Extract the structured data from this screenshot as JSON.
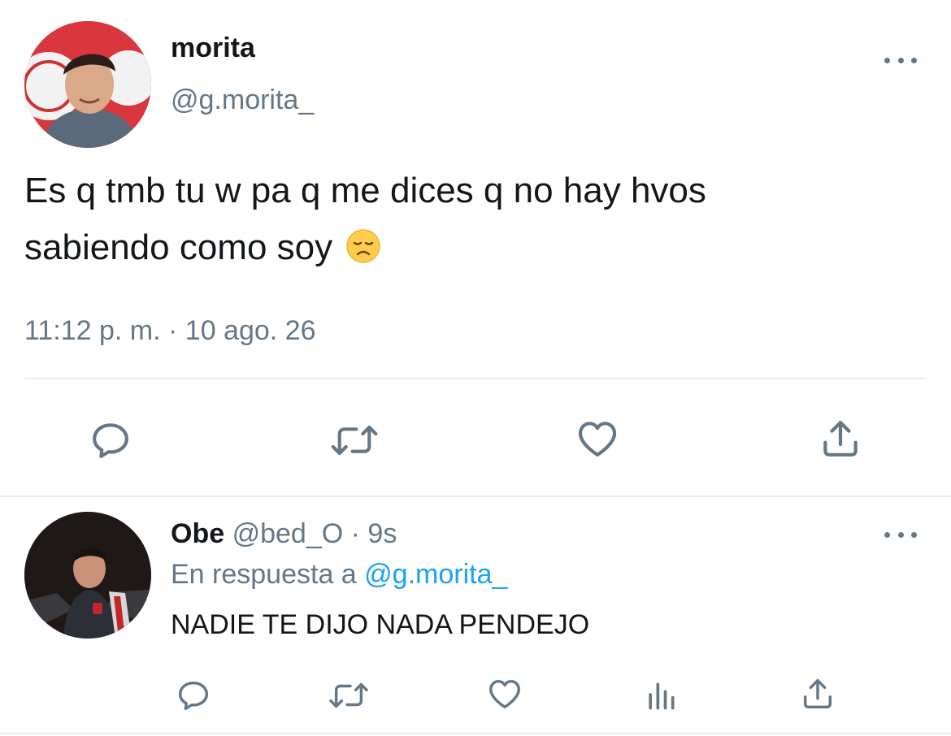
{
  "tweet": {
    "author_name": "morita",
    "author_handle": "@g.morita_",
    "text_line1": "Es q tmb tu w pa q me dices q no hay hvos",
    "text_line2": "sabiendo como soy",
    "emoji": "disappointed-face",
    "timestamp": "11:12 p. m. · 10 ago. 26"
  },
  "reply": {
    "author_name": "Obe",
    "author_handle": "@bed_O",
    "separator": "·",
    "time_ago": "9s",
    "in_reply_prefix": "En respuesta a",
    "in_reply_handle": "@g.morita_",
    "text": "NADIE TE DIJO NADA PENDEJO"
  },
  "icons": {
    "tweet_actions": [
      "reply-icon",
      "retweet-icon",
      "like-icon",
      "share-icon"
    ],
    "reply_actions": [
      "reply-icon",
      "retweet-icon",
      "like-icon",
      "analytics-icon",
      "share-icon"
    ]
  },
  "colors": {
    "primary_text": "#14171a",
    "secondary_text": "#657786",
    "link": "#1da1f2",
    "divider": "#e6ecf0"
  }
}
